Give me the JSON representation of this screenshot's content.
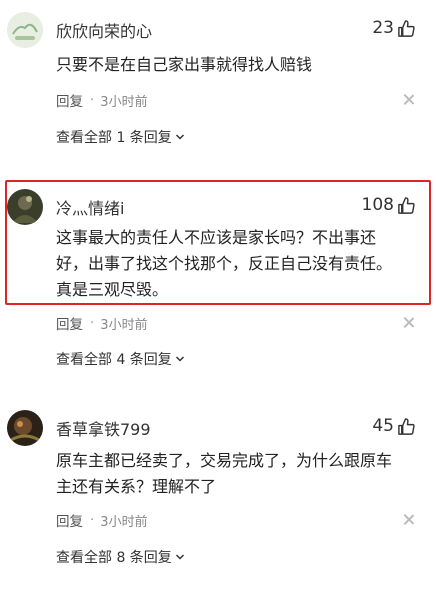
{
  "comments": [
    {
      "username": "欣欣向荣的心",
      "likes": "23",
      "text": "只要不是在自己家出事就得找人赔钱",
      "reply_label": "回复",
      "separator": "·",
      "time": "3小时前",
      "view_all": "查看全部 1 条回复",
      "avatar_icon": "avatar-image",
      "like_icon": "thumbs-up-icon"
    },
    {
      "username": "冷灬情绪i",
      "likes": "108",
      "text_lines": [
        "这事最大的责任人不应该是家长吗？不出事还",
        "好，出事了找这个找那个，反正自己没有责任。",
        "真是三观尽毁。"
      ],
      "reply_label": "回复",
      "separator": "·",
      "time": "3小时前",
      "view_all": "查看全部 4 条回复",
      "highlight_color": "#e02424"
    },
    {
      "username": "香草拿铁799",
      "likes": "45",
      "text_lines": [
        "原车主都已经卖了，交易完成了，为什么跟原车",
        "主还有关系？理解不了"
      ],
      "reply_label": "回复",
      "separator": "·",
      "time": "3小时前",
      "view_all": "查看全部 8 条回复"
    }
  ]
}
